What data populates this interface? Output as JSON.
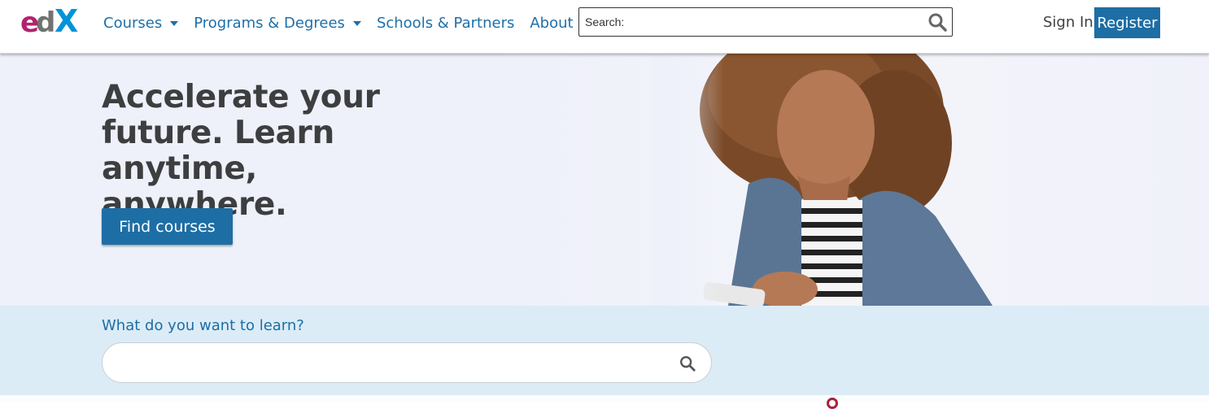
{
  "brand": {
    "logo_text": "edX",
    "colors": {
      "e": "#b0236e",
      "d": "#4a4a4a",
      "x": "#0094d8",
      "primary": "#1d6ea5",
      "link": "#1f6fa8"
    }
  },
  "nav": {
    "items": [
      {
        "label": "Courses",
        "has_caret": true
      },
      {
        "label": "Programs & Degrees",
        "has_caret": true
      },
      {
        "label": "Schools & Partners",
        "has_caret": false
      },
      {
        "label": "About",
        "has_caret": true
      }
    ]
  },
  "top_search": {
    "placeholder": "Search:",
    "icon": "search-icon"
  },
  "auth": {
    "sign_in": "Sign In",
    "register": "Register"
  },
  "hero": {
    "title": "Accelerate your future. Learn anytime, anywhere.",
    "cta": "Find courses"
  },
  "learn": {
    "label": "What do you want to learn?",
    "placeholder": "",
    "icon": "search-icon"
  }
}
